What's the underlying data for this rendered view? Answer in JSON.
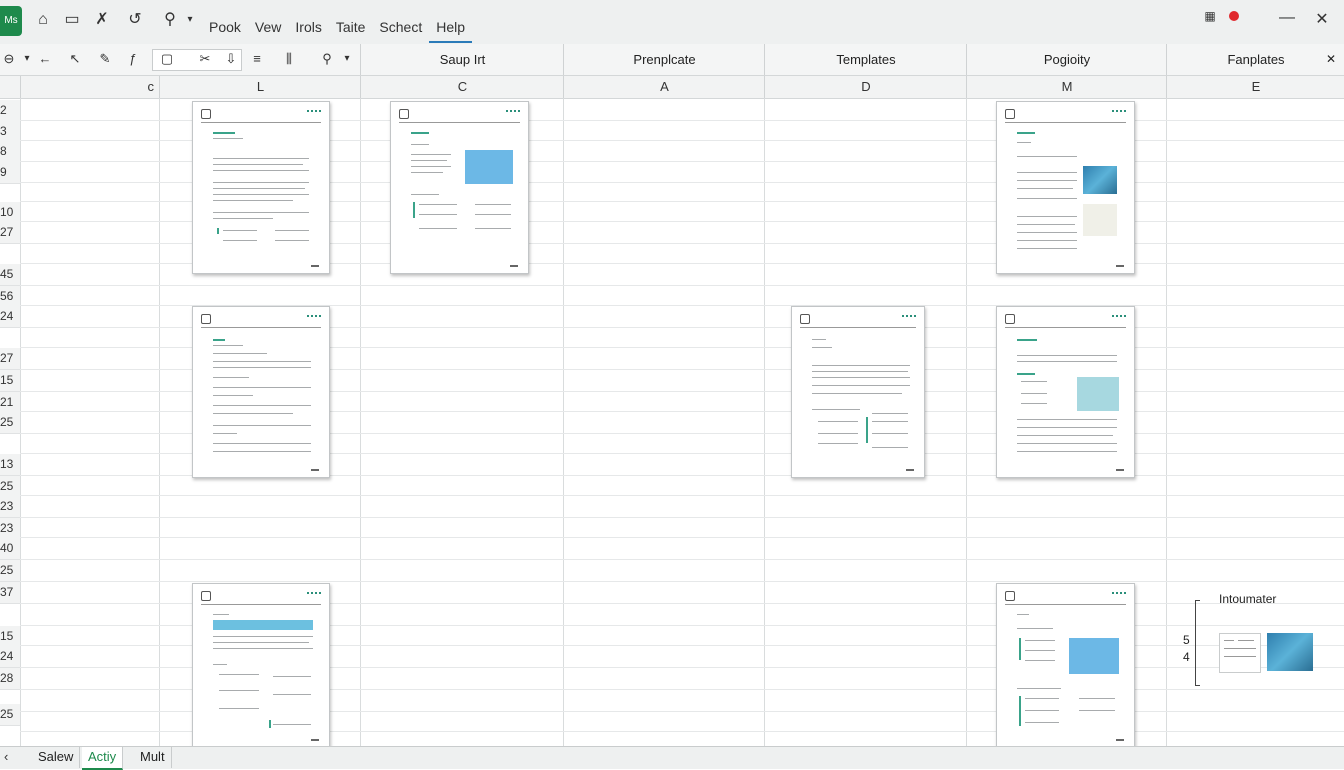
{
  "app": {
    "logo_text": "Ms"
  },
  "menu": [
    {
      "label": "Pook"
    },
    {
      "label": "Vew"
    },
    {
      "label": "Irols"
    },
    {
      "label": "Taite"
    },
    {
      "label": "Schect"
    },
    {
      "label": "Help"
    }
  ],
  "column_headers": [
    {
      "label": "Saup Irt"
    },
    {
      "label": "Prenplcate"
    },
    {
      "label": "Templates"
    },
    {
      "label": "Pogioity"
    },
    {
      "label": "Fanplates"
    }
  ],
  "column_letters": [
    {
      "label": "c"
    },
    {
      "label": "L"
    },
    {
      "label": "C"
    },
    {
      "label": "A"
    },
    {
      "label": "D"
    },
    {
      "label": "M"
    },
    {
      "label": "E"
    }
  ],
  "row_numbers": [
    "2",
    "3",
    "8",
    "9",
    "10",
    "27",
    "45",
    "56",
    "24",
    "27",
    "15",
    "21",
    "25",
    "13",
    "25",
    "23",
    "23",
    "40",
    "25",
    "37",
    "15",
    "24",
    "28",
    "25"
  ],
  "panel": {
    "title": "Intoumater",
    "numbers": [
      "5",
      "4"
    ]
  },
  "sheet_tabs": [
    {
      "label": "Salew",
      "active": false
    },
    {
      "label": "Actiy",
      "active": true
    },
    {
      "label": "Mult",
      "active": false
    }
  ],
  "colors": {
    "accent": "#1e8a4c",
    "menu_underline": "#2b7bb9",
    "record_dot": "#e0282d",
    "doc_image_blue": "#6cb8e6"
  },
  "icons": {
    "home": "home-icon",
    "folder": "folder-icon",
    "search": "search-icon",
    "close": "close-icon",
    "minimize": "minimize-icon"
  }
}
